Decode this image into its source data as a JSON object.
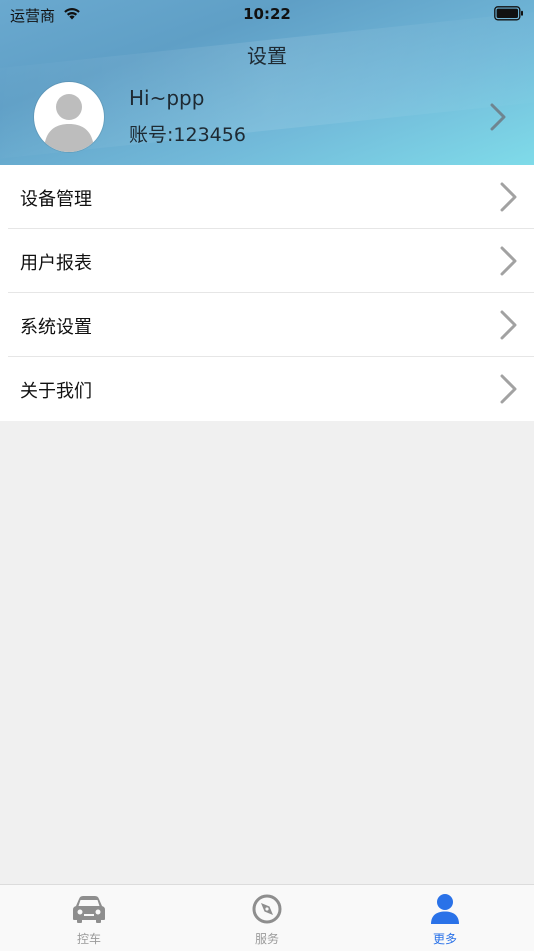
{
  "status_bar": {
    "carrier": "运营商",
    "time": "10:22"
  },
  "header": {
    "title": "设置",
    "greeting": "Hi~ppp",
    "account_label": "账号:",
    "account_number": "123456"
  },
  "menu": {
    "items": [
      {
        "label": "设备管理",
        "icon": "chevron-right-icon"
      },
      {
        "label": "用户报表",
        "icon": "chevron-right-icon"
      },
      {
        "label": "系统设置",
        "icon": "chevron-right-icon"
      },
      {
        "label": "关于我们",
        "icon": "chevron-right-icon"
      }
    ]
  },
  "tabbar": {
    "tabs": [
      {
        "label": "控车",
        "icon": "car-icon",
        "active": false
      },
      {
        "label": "服务",
        "icon": "compass-icon",
        "active": false
      },
      {
        "label": "更多",
        "icon": "person-icon",
        "active": true
      }
    ]
  },
  "colors": {
    "accent": "#2a72e8",
    "inactive_tab": "#9b9b9b",
    "header_gradient_start": "#6aa9cf",
    "header_gradient_end": "#7fdbe9",
    "background": "#f0f0f0"
  }
}
